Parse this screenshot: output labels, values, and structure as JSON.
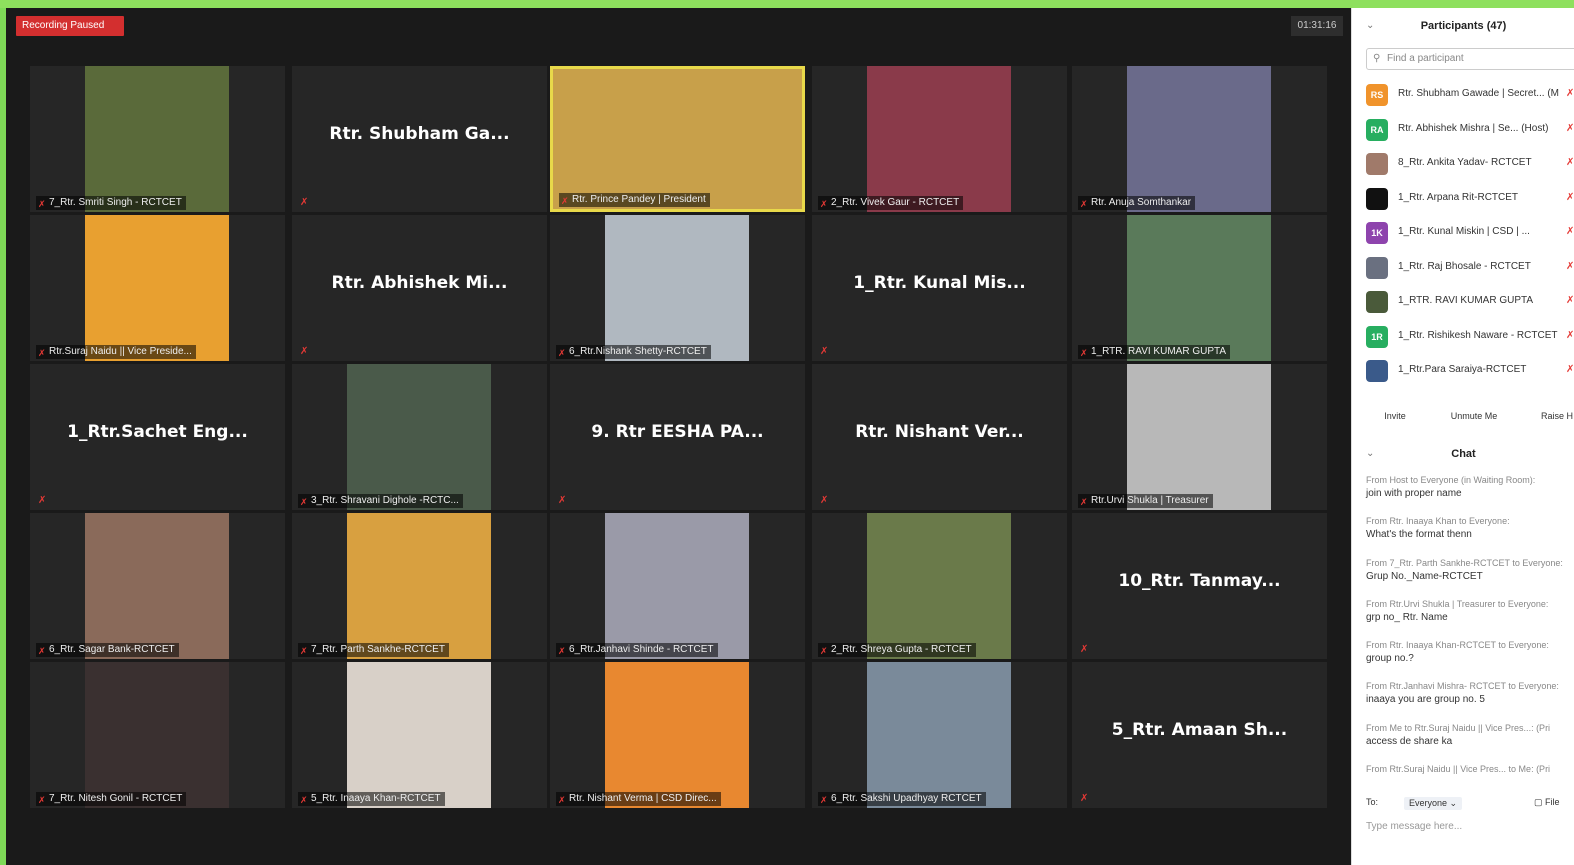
{
  "meeting": {
    "recording_label": "Recording Paused",
    "timer": "01:31:16",
    "tiles": [
      {
        "label": "7_Rtr. Smriti Singh - RCTCET",
        "type": "video",
        "color": "#5a6a3a"
      },
      {
        "label": "",
        "big": "Rtr. Shubham Ga...",
        "type": "name"
      },
      {
        "label": "Rtr. Prince Pandey | President",
        "type": "video",
        "color": "#c8a04a",
        "active": true
      },
      {
        "label": "2_Rtr. Vivek Gaur - RCTCET",
        "type": "video",
        "color": "#8a3a4a"
      },
      {
        "label": "Rtr. Anuja Somthankar",
        "type": "video",
        "color": "#6a6a8a"
      },
      {
        "label": "Rtr.Suraj Naidu || Vice Preside...",
        "type": "video",
        "color": "#e8a030"
      },
      {
        "label": "",
        "big": "Rtr. Abhishek Mi...",
        "type": "name"
      },
      {
        "label": "6_Rtr.Nishank Shetty-RCTCET",
        "type": "video",
        "color": "#b0b8c0"
      },
      {
        "label": "",
        "big": "1_Rtr. Kunal Mis...",
        "type": "name"
      },
      {
        "label": "1_RTR. RAVI KUMAR GUPTA",
        "type": "video",
        "color": "#5a7a5a"
      },
      {
        "label": "",
        "big": "1_Rtr.Sachet Eng...",
        "type": "name"
      },
      {
        "label": "3_Rtr. Shravani Dighole -RCTC...",
        "type": "video",
        "color": "#4a5a4a"
      },
      {
        "label": "",
        "big": "9. Rtr EESHA PA...",
        "type": "name"
      },
      {
        "label": "",
        "big": "Rtr. Nishant Ver...",
        "type": "name"
      },
      {
        "label": "Rtr.Urvi Shukla | Treasurer",
        "type": "video",
        "color": "#b8b8b8"
      },
      {
        "label": "6_Rtr. Sagar Bank-RCTCET",
        "type": "video",
        "color": "#8a6a5a"
      },
      {
        "label": "7_Rtr. Parth Sankhe-RCTCET",
        "type": "video",
        "color": "#d8a040"
      },
      {
        "label": "6_Rtr.Janhavi Shinde - RCTCET",
        "type": "video",
        "color": "#9a9aa8"
      },
      {
        "label": "2_Rtr. Shreya Gupta - RCTCET",
        "type": "video",
        "color": "#6a7a4a"
      },
      {
        "label": "",
        "big": "10_Rtr. Tanmay...",
        "type": "name"
      },
      {
        "label": "7_Rtr. Nitesh Gonil - RCTCET",
        "type": "video",
        "color": "#3a3030"
      },
      {
        "label": "5_Rtr. Inaaya Khan-RCTCET",
        "type": "video",
        "color": "#d8d0c8"
      },
      {
        "label": "Rtr. Nishant Verma | CSD Direc...",
        "type": "video",
        "color": "#e88830"
      },
      {
        "label": "6_Rtr. Sakshi Upadhyay RCTCET",
        "type": "video",
        "color": "#7a8a9a"
      },
      {
        "label": "",
        "big": "5_Rtr. Amaan Sh...",
        "type": "name"
      }
    ]
  },
  "panel": {
    "participants_title": "Participants (47)",
    "search_placeholder": "Find a participant",
    "participants": [
      {
        "name": "Rtr. Shubham Gawade | Secret... (M",
        "initials": "RS",
        "color": "#f0932b"
      },
      {
        "name": "Rtr. Abhishek Mishra | Se... (Host)",
        "initials": "RA",
        "color": "#27ae60"
      },
      {
        "name": "8_Rtr. Ankita Yadav- RCTCET",
        "initials": "",
        "color": "#a07a6a"
      },
      {
        "name": "1_Rtr. Arpana Rit-RCTCET",
        "initials": "",
        "color": "#111111"
      },
      {
        "name": "1_Rtr. Kunal Miskin | CSD | ...",
        "initials": "1K",
        "color": "#8e44ad"
      },
      {
        "name": "1_Rtr. Raj Bhosale - RCTCET",
        "initials": "",
        "color": "#6a7080"
      },
      {
        "name": "1_RTR. RAVI KUMAR GUPTA",
        "initials": "",
        "color": "#4a5a3a"
      },
      {
        "name": "1_Rtr. Rishikesh Naware - RCTCET",
        "initials": "1R",
        "color": "#27ae60"
      },
      {
        "name": "1_Rtr.Para Saraiya-RCTCET",
        "initials": "",
        "color": "#3a5a8a"
      }
    ],
    "buttons": {
      "invite": "Invite",
      "unmute": "Unmute Me",
      "raise": "Raise H"
    },
    "chat_title": "Chat",
    "messages": [
      {
        "from": "From Host to Everyone (in Waiting Room):",
        "text": "join with proper name"
      },
      {
        "from": "From Rtr. Inaaya Khan to Everyone:",
        "text": "What's the format thenn"
      },
      {
        "from": "From 7_Rtr. Parth Sankhe-RCTCET to Everyone:",
        "text": "Grup No._Name-RCTCET"
      },
      {
        "from": "From Rtr.Urvi Shukla | Treasurer to Everyone:",
        "text": "grp no_ Rtr. Name"
      },
      {
        "from": "From Rtr. Inaaya Khan-RCTCET to Everyone:",
        "text": "group no.?"
      },
      {
        "from": "From Rtr.Janhavi Mishra- RCTCET to Everyone:",
        "text": "inaaya you are group no. 5"
      },
      {
        "from": "From Me to Rtr.Suraj Naidu || Vice Pres...: (Pri",
        "text": "access de share ka"
      },
      {
        "from": "From Rtr.Suraj Naidu || Vice Pres... to Me: (Pri",
        "text": ""
      }
    ],
    "to_label": "To:",
    "to_value": "Everyone",
    "file_label": "File",
    "type_placeholder": "Type message here..."
  }
}
